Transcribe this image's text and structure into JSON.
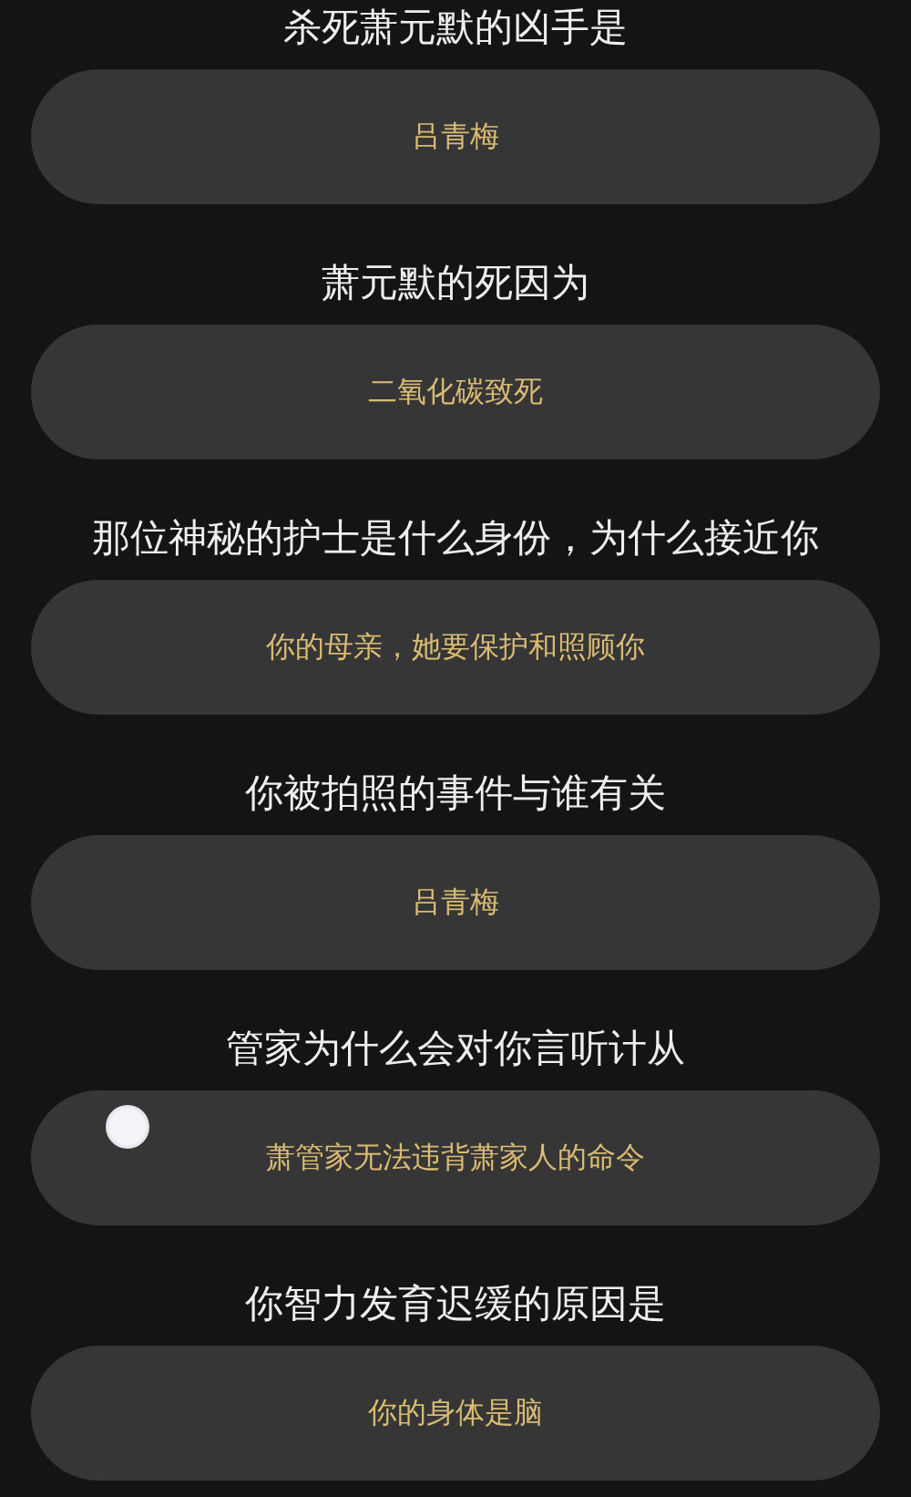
{
  "questions": [
    {
      "question": "杀死萧元默的凶手是",
      "answer": "吕青梅"
    },
    {
      "question": "萧元默的死因为",
      "answer": "二氧化碳致死"
    },
    {
      "question": "那位神秘的护士是什么身份，为什么接近你",
      "answer": "你的母亲，她要保护和照顾你"
    },
    {
      "question": "你被拍照的事件与谁有关",
      "answer": "吕青梅"
    },
    {
      "question": "管家为什么会对你言听计从",
      "answer": "萧管家无法违背萧家人的命令"
    },
    {
      "question": "你智力发育迟缓的原因是",
      "answer": "你的身体是脑"
    }
  ]
}
